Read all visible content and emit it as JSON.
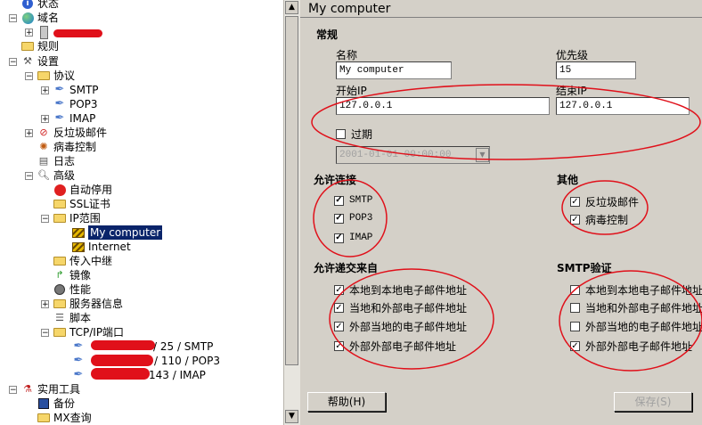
{
  "tree": {
    "items": [
      {
        "label": "状态",
        "icon": "info-icon"
      },
      {
        "label": "域名",
        "icon": "globe-icon",
        "exp": "−"
      },
      {
        "label": "",
        "icon": "server-icon",
        "exp": "+"
      },
      {
        "label": "规则",
        "icon": "folder-icon"
      },
      {
        "label": "设置",
        "icon": "tools-icon",
        "exp": "−"
      },
      {
        "label": "协议",
        "icon": "folder-icon",
        "exp": "−"
      },
      {
        "label": "SMTP",
        "icon": "feather-icon",
        "exp": "+"
      },
      {
        "label": "POP3",
        "icon": "feather-icon"
      },
      {
        "label": "IMAP",
        "icon": "feather-icon",
        "exp": "+"
      },
      {
        "label": "反垃圾邮件",
        "icon": "no-spam-icon",
        "exp": "+"
      },
      {
        "label": "病毒控制",
        "icon": "virus-icon"
      },
      {
        "label": "日志",
        "icon": "log-icon"
      },
      {
        "label": "高级",
        "icon": "magnifier-icon",
        "exp": "−"
      },
      {
        "label": "自动停用",
        "icon": "stop-icon"
      },
      {
        "label": "SSL证书",
        "icon": "folder-icon"
      },
      {
        "label": "IP范围",
        "icon": "folder-icon",
        "exp": "−"
      },
      {
        "label": "My computer",
        "icon": "computer-icon"
      },
      {
        "label": "Internet",
        "icon": "computer-icon"
      },
      {
        "label": "传入中继",
        "icon": "folder-icon"
      },
      {
        "label": "镜像",
        "icon": "mirror-icon"
      },
      {
        "label": "性能",
        "icon": "gauge-icon"
      },
      {
        "label": "服务器信息",
        "icon": "folder-icon",
        "exp": "+"
      },
      {
        "label": "脚本",
        "icon": "script-icon"
      },
      {
        "label": "TCP/IP端口",
        "icon": "folder-icon",
        "exp": "−"
      },
      {
        "label": "/ 25 / SMTP",
        "icon": "feather-icon"
      },
      {
        "label": "/ 110 / POP3",
        "icon": "feather-icon"
      },
      {
        "label": "143 / IMAP",
        "icon": "feather-icon"
      },
      {
        "label": "实用工具",
        "icon": "utility-icon",
        "exp": "−"
      },
      {
        "label": "备份",
        "icon": "save-icon"
      },
      {
        "label": "MX查询",
        "icon": "folder-icon"
      }
    ]
  },
  "header": {
    "title": "My computer"
  },
  "general": {
    "heading": "常规",
    "name_label": "名称",
    "name_value": "My computer",
    "priority_label": "优先级",
    "priority_value": "15",
    "start_ip_label": "开始IP",
    "start_ip_value": "127.0.0.1",
    "end_ip_label": "结束IP",
    "end_ip_value": "127.0.0.1",
    "expire_label": "过期",
    "expire_date": "2001-01-01 00:00:00"
  },
  "allow_conn": {
    "heading": "允许连接",
    "items": [
      "SMTP",
      "POP3",
      "IMAP"
    ]
  },
  "other": {
    "heading": "其他",
    "items": [
      "反垃圾邮件",
      "病毒控制"
    ]
  },
  "allow_from": {
    "heading": "允许递交来自",
    "items": [
      "本地到本地电子邮件地址",
      "当地和外部电子邮件地址",
      "外部当地的电子邮件地址",
      "外部外部电子邮件地址"
    ]
  },
  "smtp_auth": {
    "heading": "SMTP验证",
    "items": [
      "本地到本地电子邮件地址",
      "当地和外部电子邮件地址",
      "外部当地的电子邮件地址",
      "外部外部电子邮件地址"
    ]
  },
  "buttons": {
    "help": "帮助(H)",
    "save": "保存(S)"
  },
  "colors": {
    "annotation": "#e0101a",
    "selection": "#0a246a"
  }
}
